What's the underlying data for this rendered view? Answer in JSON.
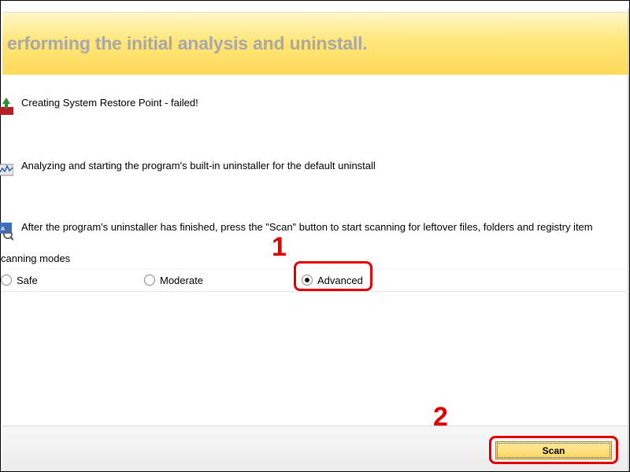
{
  "top_partial_text": "",
  "banner": {
    "title": "erforming the initial analysis and uninstall."
  },
  "steps": [
    {
      "icon": "restore",
      "text": "Creating System Restore Point - failed!"
    },
    {
      "icon": "analyze",
      "text": "Analyzing and starting the program's built-in uninstaller for the default uninstall"
    },
    {
      "icon": "scan",
      "text": "After the program's uninstaller has finished, press the \"Scan\" button to start scanning for leftover files, folders and registry item"
    }
  ],
  "scanning_modes": {
    "label": "canning modes",
    "options": [
      "Safe",
      "Moderate",
      "Advanced"
    ],
    "selected": "Advanced"
  },
  "buttons": {
    "scan": "Scan"
  },
  "callouts": {
    "c1": "1",
    "c2": "2"
  },
  "colors": {
    "highlight": "#e00000",
    "banner_grad_top": "#fff7c9",
    "banner_grad_bottom": "#ffd95b",
    "scan_btn_top": "#ffe9a2",
    "scan_btn_bottom": "#ffd65c"
  }
}
